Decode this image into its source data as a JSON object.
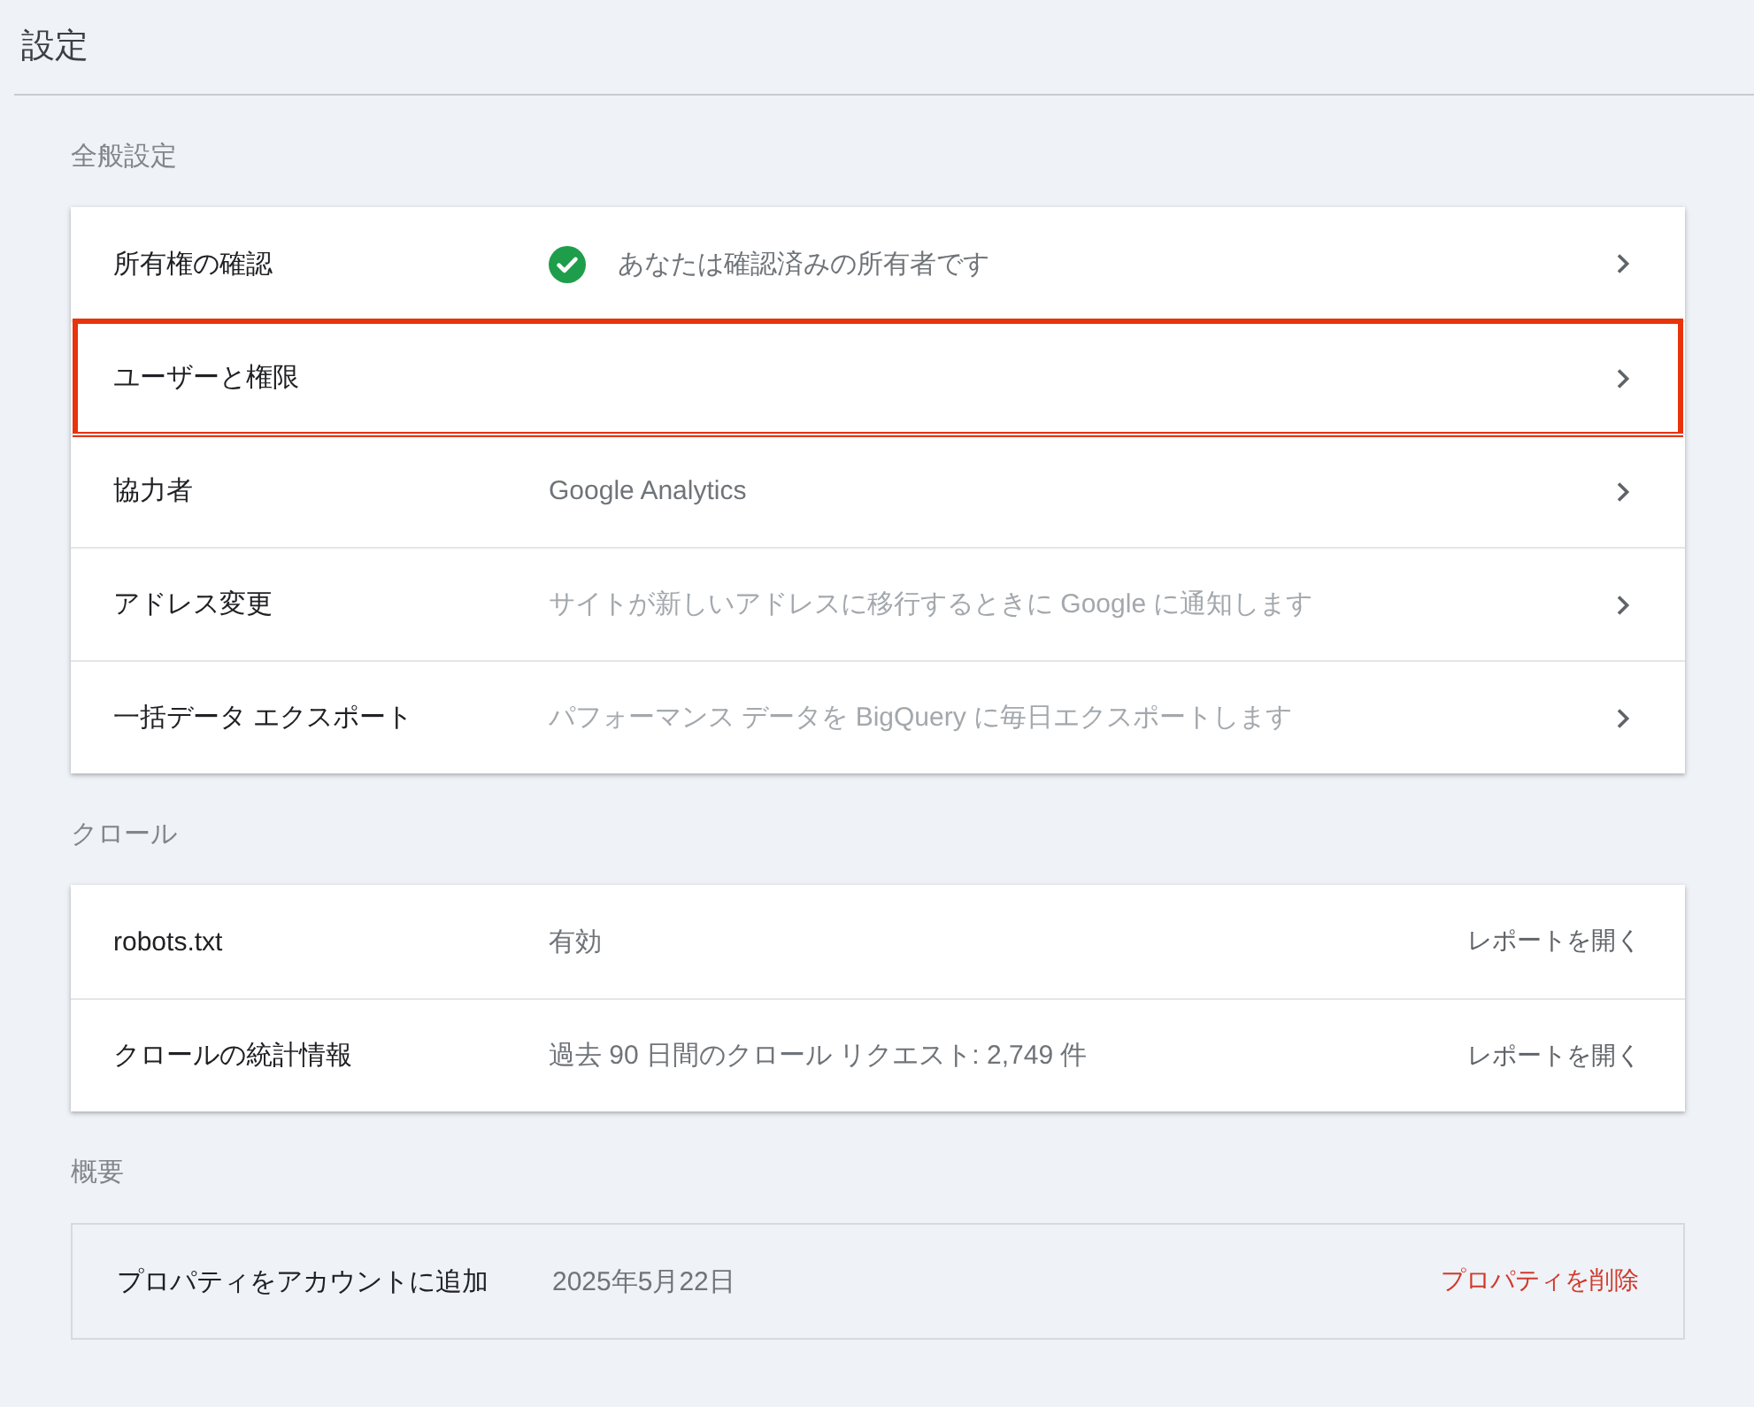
{
  "page": {
    "title": "設定"
  },
  "sections": [
    {
      "heading": "全般設定",
      "kind": "card",
      "rows": [
        {
          "label": "所有権の確認",
          "value": "あなたは確認済みの所有者です",
          "verified": true,
          "dimmed": false,
          "highlighted": false,
          "action": {
            "kind": "chevron"
          }
        },
        {
          "label": "ユーザーと権限",
          "verified": false,
          "highlighted": true,
          "action": {
            "kind": "chevron"
          }
        },
        {
          "label": "協力者",
          "value": "Google Analytics",
          "verified": false,
          "dimmed": false,
          "highlighted": false,
          "action": {
            "kind": "chevron"
          }
        },
        {
          "label": "アドレス変更",
          "value": "サイトが新しいアドレスに移行するときに Google に通知します",
          "verified": false,
          "dimmed": true,
          "highlighted": false,
          "action": {
            "kind": "chevron"
          }
        },
        {
          "label": "一括データ エクスポート",
          "value": "パフォーマンス データを BigQuery に毎日エクスポートします",
          "verified": false,
          "dimmed": true,
          "highlighted": false,
          "action": {
            "kind": "chevron"
          }
        }
      ]
    },
    {
      "heading": "クロール",
      "kind": "card",
      "rows": [
        {
          "label": "robots.txt",
          "value": "有効",
          "dimmed": false,
          "action": {
            "kind": "link",
            "label": "レポートを開く"
          }
        },
        {
          "label": "クロールの統計情報",
          "value": "過去 90 日間のクロール リクエスト: 2,749 件",
          "dimmed": false,
          "action": {
            "kind": "link",
            "label": "レポートを開く"
          }
        }
      ]
    },
    {
      "heading": "概要",
      "kind": "outlined",
      "rows": [
        {
          "label": "プロパティをアカウントに追加",
          "value": "2025年5月22日",
          "dimmed": false,
          "action": {
            "kind": "danger",
            "label": "プロパティを削除"
          }
        }
      ]
    }
  ]
}
